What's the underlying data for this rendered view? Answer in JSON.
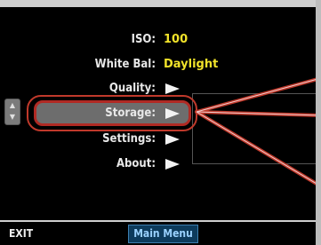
{
  "menu": {
    "items": [
      {
        "label": "ISO:",
        "value": "100",
        "type": "value"
      },
      {
        "label": "White Bal:",
        "value": "Daylight",
        "type": "value"
      },
      {
        "label": "Quality:",
        "value": "",
        "type": "submenu"
      },
      {
        "label": "Storage:",
        "value": "",
        "type": "submenu",
        "selected": true
      },
      {
        "label": "Settings:",
        "value": "",
        "type": "submenu"
      },
      {
        "label": "About:",
        "value": "",
        "type": "submenu"
      }
    ],
    "scroll_up_glyph": "▲",
    "scroll_down_glyph": "▼"
  },
  "status_bar": {
    "exit_label": "EXIT",
    "title": "Main Menu"
  },
  "colors": {
    "background": "#000000",
    "label": "#e8e8e8",
    "value": "#f1e32a",
    "selection_fill": "#6d6d6d",
    "callout": "#c0392b",
    "title_fill": "#0d3b5c",
    "title_text": "#9ad2ff"
  },
  "icons": {
    "submenu_arrow": "arrow-right-icon",
    "scroll": "scroll-up-down-icon"
  }
}
